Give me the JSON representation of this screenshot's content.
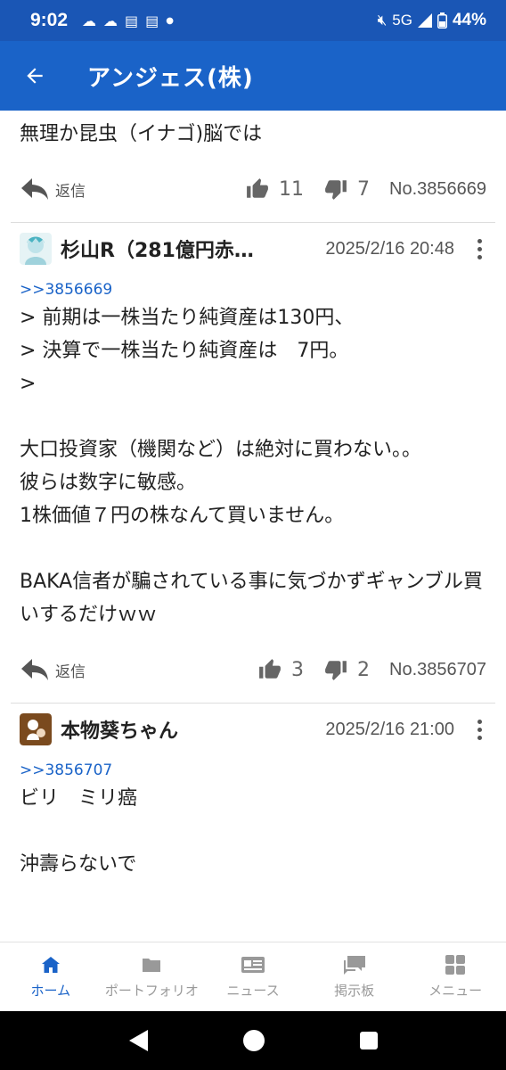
{
  "status_bar": {
    "time": "9:02",
    "network": "5G",
    "battery": "44%"
  },
  "app_bar": {
    "title": "アンジェス(株)"
  },
  "posts": [
    {
      "body": "無理か昆虫（イナゴ)脳では",
      "reply_label": "返信",
      "likes": "11",
      "dislikes": "7",
      "number": "No.3856669"
    },
    {
      "author": "杉山R（281億円赤…",
      "date": "2025/2/16 20:48",
      "reply_to": ">>3856669",
      "body": "> 前期は一株当たり純資産は130円、\n> 決算で一株当たり純資産は　7円。\n>\n\n大口投資家（機関など）は絶対に買わない。。\n彼らは数字に敏感。\n1株価値７円の株なんて買いません。\n\nBAKA信者が騙されている事に気づかずギャンブル買いするだけｗｗ",
      "reply_label": "返信",
      "likes": "3",
      "dislikes": "2",
      "number": "No.3856707"
    },
    {
      "author": "本物葵ちゃん",
      "date": "2025/2/16 21:00",
      "reply_to": ">>3856707",
      "body": "ビリ　ミリ癌\n\n沖壽らないで"
    }
  ],
  "bottom_nav": {
    "items": [
      {
        "label": "ホーム",
        "icon": "home-icon",
        "active": true
      },
      {
        "label": "ポートフォリオ",
        "icon": "folder-icon",
        "active": false
      },
      {
        "label": "ニュース",
        "icon": "newspaper-icon",
        "active": false
      },
      {
        "label": "掲示板",
        "icon": "chat-icon",
        "active": false
      },
      {
        "label": "メニュー",
        "icon": "grid-icon",
        "active": false
      }
    ]
  },
  "colors": {
    "status_bar": "#1a56b5",
    "app_bar": "#1a63c8",
    "accent": "#1a63c8"
  }
}
